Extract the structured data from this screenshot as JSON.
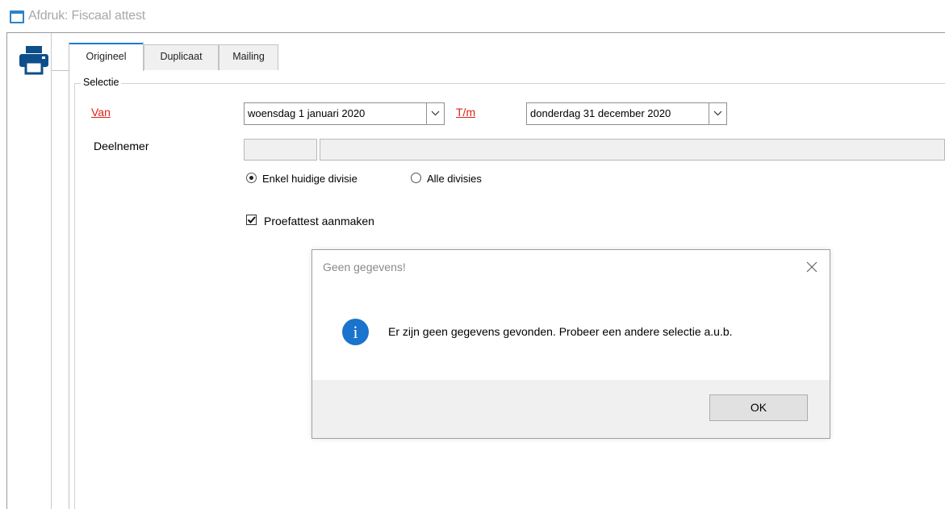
{
  "window": {
    "title": "Afdruk: Fiscaal attest",
    "icon": "window-icon"
  },
  "toolbar": {
    "print_icon": "printer-icon"
  },
  "tabs": [
    {
      "label": "Origineel",
      "active": true
    },
    {
      "label": "Duplicaat",
      "active": false
    },
    {
      "label": "Mailing",
      "active": false
    }
  ],
  "selection": {
    "group_title": "Selectie",
    "from_label": "Van",
    "from_value": "woensdag 1 januari 2020",
    "to_label": "T/m",
    "to_value": "donderdag 31 december 2020",
    "participant_label": "Deelnemer",
    "participant_code": "",
    "participant_name": "",
    "division_options": [
      {
        "label": "Enkel huidige divisie",
        "checked": true
      },
      {
        "label": "Alle divisies",
        "checked": false
      }
    ],
    "proof_checkbox_label": "Proefattest aanmaken",
    "proof_checked": true
  },
  "dialog": {
    "title": "Geen gegevens!",
    "icon": "info-icon",
    "message": "Er zijn geen gegevens gevonden. Probeer een andere selectie a.u.b.",
    "ok_label": "OK"
  },
  "colors": {
    "accent": "#1c7ad4",
    "required_label": "#e0201a",
    "info_icon": "#1a73cc"
  }
}
